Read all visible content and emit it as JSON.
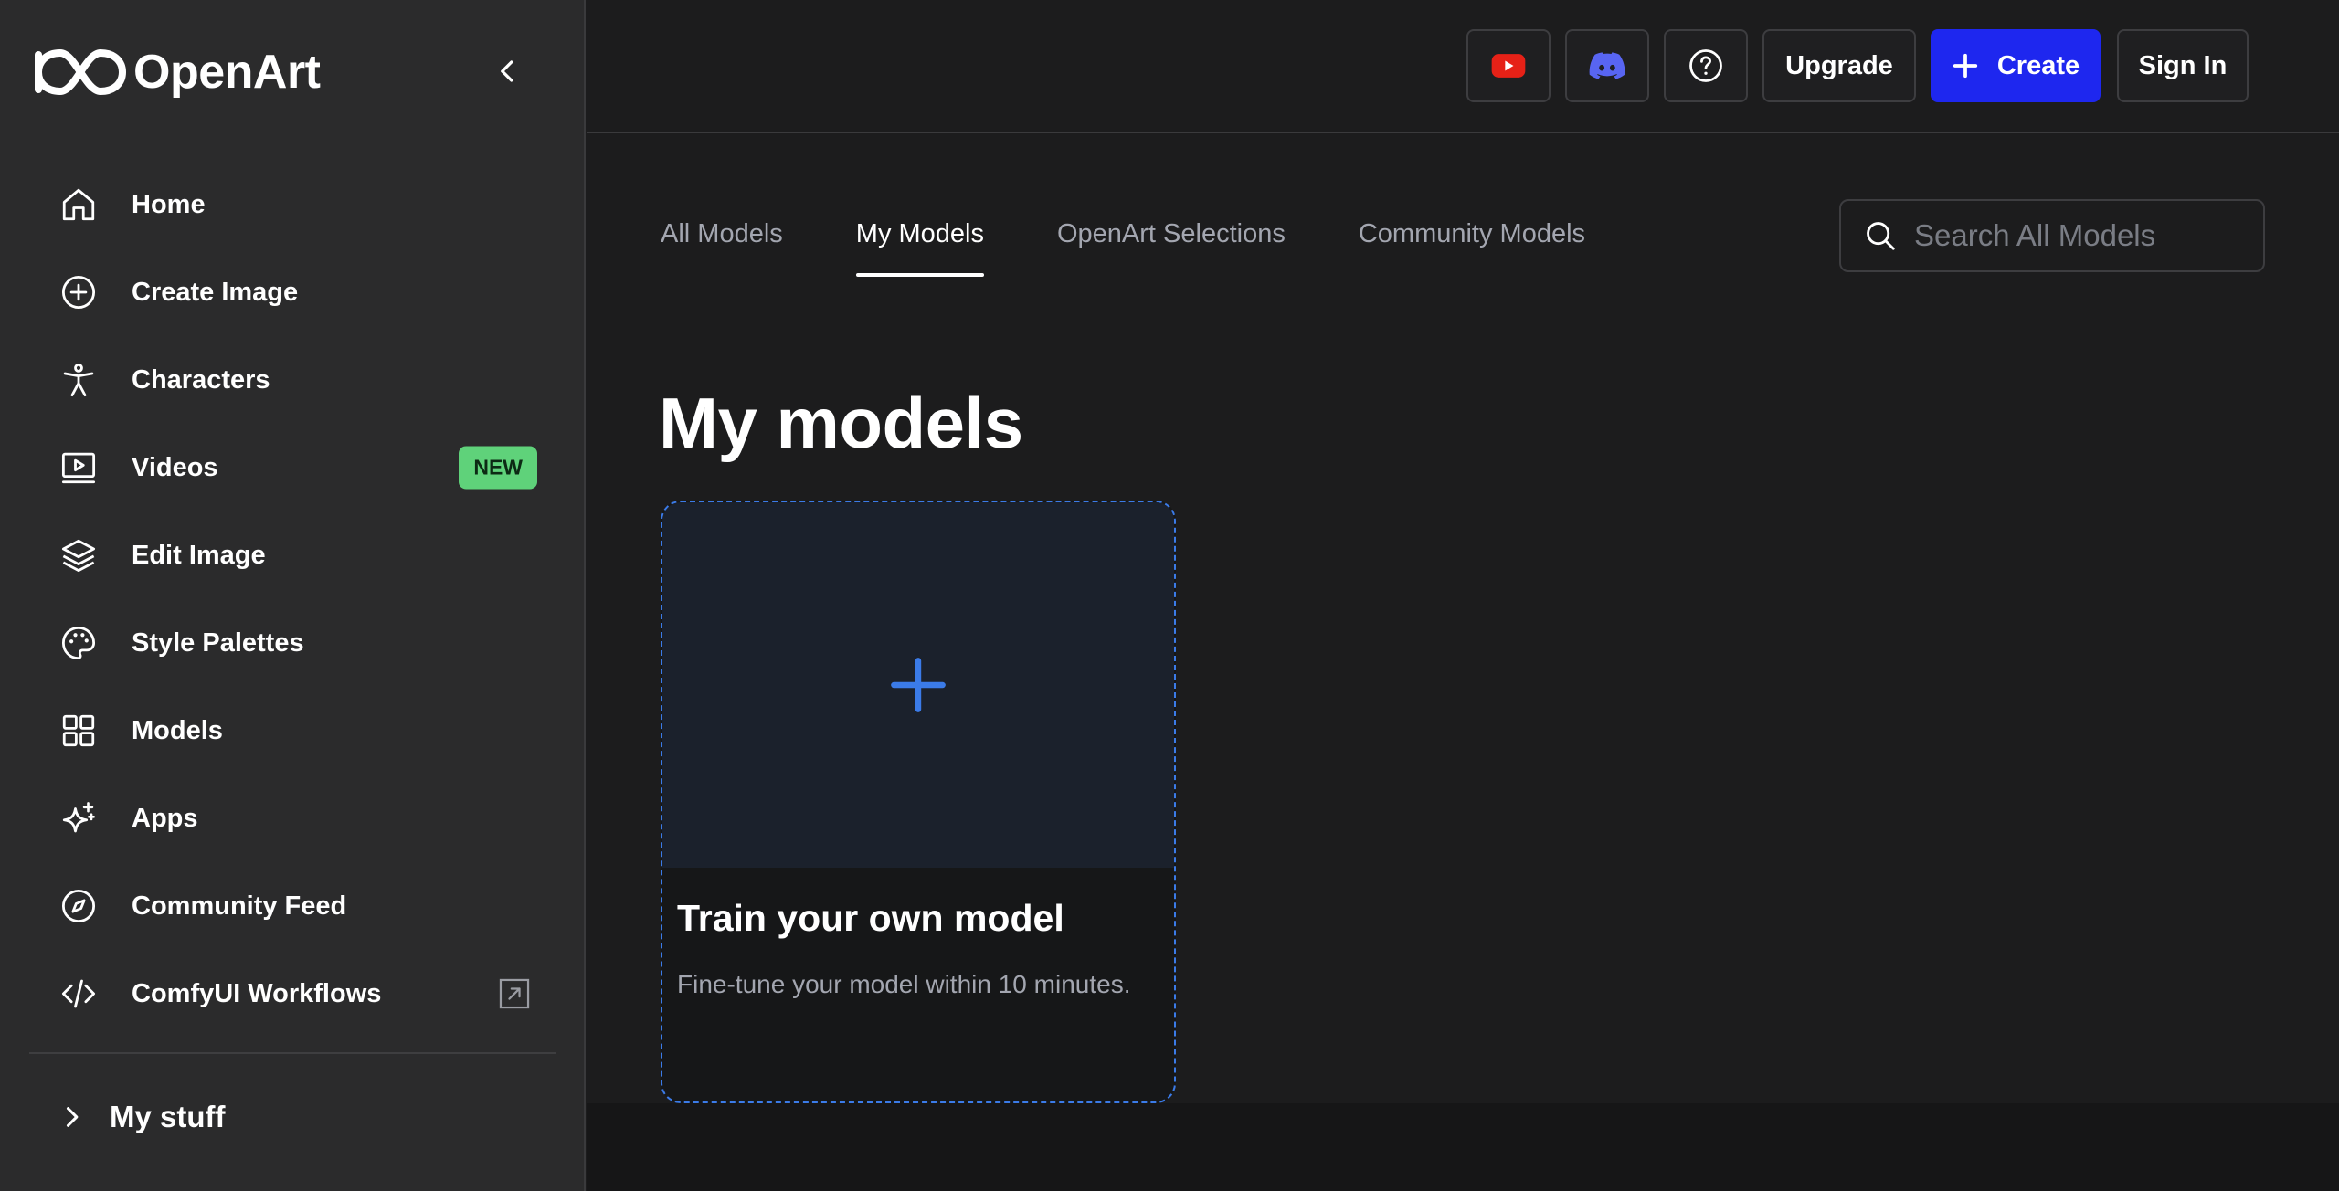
{
  "brand": {
    "name": "OpenArt"
  },
  "sidebar": {
    "items": [
      {
        "label": "Home",
        "icon": "home-icon"
      },
      {
        "label": "Create Image",
        "icon": "plus-circle-icon"
      },
      {
        "label": "Characters",
        "icon": "person-icon"
      },
      {
        "label": "Videos",
        "icon": "video-icon",
        "badge": "NEW"
      },
      {
        "label": "Edit Image",
        "icon": "layers-icon"
      },
      {
        "label": "Style Palettes",
        "icon": "palette-icon"
      },
      {
        "label": "Models",
        "icon": "grid-icon"
      },
      {
        "label": "Apps",
        "icon": "sparkles-icon"
      },
      {
        "label": "Community Feed",
        "icon": "compass-icon"
      },
      {
        "label": "ComfyUI Workflows",
        "icon": "code-icon",
        "external": true
      }
    ],
    "my_stuff": "My stuff"
  },
  "header": {
    "upgrade": "Upgrade",
    "create": "Create",
    "sign_in": "Sign In"
  },
  "tabs": [
    {
      "label": "All Models",
      "active": false
    },
    {
      "label": "My Models",
      "active": true
    },
    {
      "label": "OpenArt Selections",
      "active": false
    },
    {
      "label": "Community Models",
      "active": false
    }
  ],
  "search": {
    "placeholder": "Search All Models"
  },
  "page_title": "My models",
  "card": {
    "title": "Train your own model",
    "description": "Fine-tune your model within 10 minutes."
  },
  "colors": {
    "accent": "#1e27ef",
    "card_border": "#3b7be8",
    "badge_new": "#5fd27a",
    "youtube": "#e62117",
    "discord": "#5865f2"
  }
}
